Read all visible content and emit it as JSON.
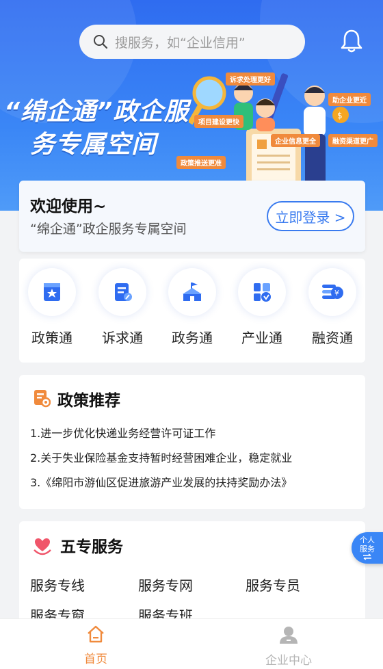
{
  "search": {
    "placeholder": "搜服务，如“企业信用”"
  },
  "banner": {
    "title_line1": "“绵企通”政企服",
    "title_line2": "务专属空间",
    "tags": [
      "诉求处理更好",
      "项目建设更快",
      "企业信息更全",
      "政策推送更准",
      "助企业更近",
      "融资渠道更广"
    ]
  },
  "welcome": {
    "title": "欢迎使用~",
    "subtitle": "“绵企通”政企服务专属空间",
    "login_label": "立即登录 >"
  },
  "quick": [
    {
      "label": "政策通",
      "icon": "badge-icon"
    },
    {
      "label": "诉求通",
      "icon": "edit-doc-icon"
    },
    {
      "label": "政务通",
      "icon": "government-building-icon"
    },
    {
      "label": "产业通",
      "icon": "industry-icon"
    },
    {
      "label": "融资通",
      "icon": "finance-icon"
    }
  ],
  "policy": {
    "title": "政策推荐",
    "items": [
      "1.进一步优化快递业务经营许可证工作",
      "2.关于失业保险基金支持暂时经营困难企业，稳定就业",
      "3.《绵阳市游仙区促进旅游产业发展的扶持奖励办法》"
    ]
  },
  "five": {
    "title": "五专服务",
    "items": [
      "服务专线",
      "服务专网",
      "服务专员",
      "服务专窗",
      "服务专班"
    ]
  },
  "float": {
    "line1": "个人",
    "line2": "服务"
  },
  "tabbar": {
    "home": "首页",
    "center": "企业中心",
    "active_color": "#f08a3c",
    "inactive_color": "#b5b5b5"
  },
  "colors": {
    "primary": "#3a7bef",
    "accent": "#f08a3c"
  }
}
